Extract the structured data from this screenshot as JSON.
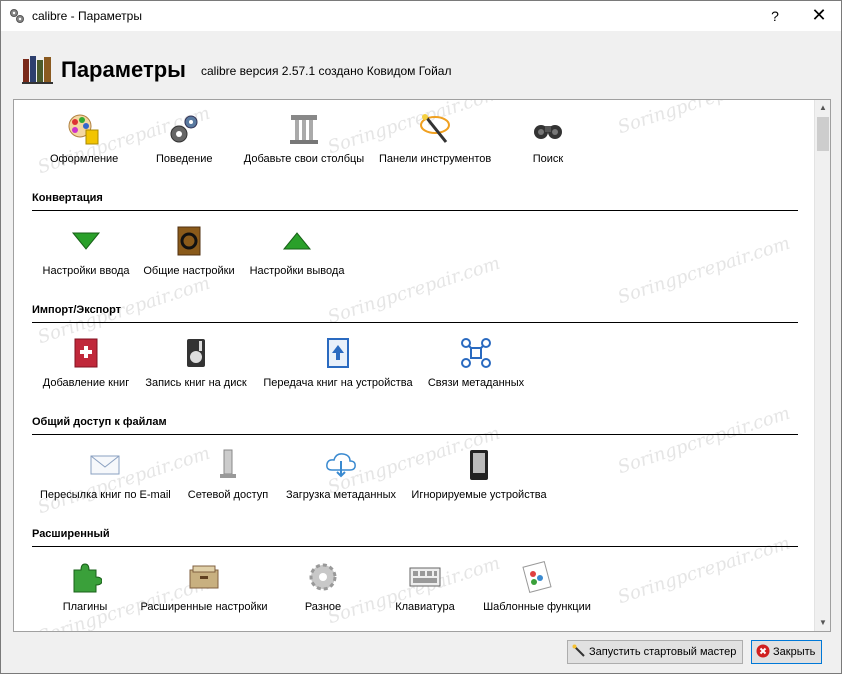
{
  "window": {
    "title": "calibre - Параметры",
    "help_label": "?",
    "close_label": "✕"
  },
  "header": {
    "title": "Параметры",
    "subtitle": "calibre версия 2.57.1 создано Ковидом Гойал"
  },
  "watermark": "Soringpcrepair.com",
  "top_items": [
    {
      "label": "Оформление",
      "icon": "appearance-icon"
    },
    {
      "label": "Поведение",
      "icon": "gears-icon"
    },
    {
      "label": "Добавьте свои столбцы",
      "icon": "column-icon"
    },
    {
      "label": "Панели инструментов",
      "icon": "wand-icon"
    },
    {
      "label": "Поиск",
      "icon": "binoculars-icon"
    }
  ],
  "sections": [
    {
      "title": "Конвертация",
      "items": [
        {
          "label": "Настройки ввода",
          "icon": "arrow-down-icon"
        },
        {
          "label": "Общие настройки",
          "icon": "book-convert-icon"
        },
        {
          "label": "Настройки вывода",
          "icon": "arrow-up-icon"
        }
      ]
    },
    {
      "title": "Импорт/Экспорт",
      "items": [
        {
          "label": "Добавление книг",
          "icon": "add-book-icon"
        },
        {
          "label": "Запись книг на диск",
          "icon": "save-disk-icon"
        },
        {
          "label": "Передача книг на устройства",
          "icon": "send-device-icon"
        },
        {
          "label": "Связи метаданных",
          "icon": "metadata-links-icon"
        }
      ]
    },
    {
      "title": "Общий доступ к файлам",
      "items": [
        {
          "label": "Пересылка книг по E-mail",
          "icon": "email-icon"
        },
        {
          "label": "Сетевой доступ",
          "icon": "network-server-icon"
        },
        {
          "label": "Загрузка метаданных",
          "icon": "cloud-download-icon"
        },
        {
          "label": "Игнорируемые устройства",
          "icon": "ereader-icon"
        }
      ]
    },
    {
      "title": "Расширенный",
      "items": [
        {
          "label": "Плагины",
          "icon": "plugin-icon"
        },
        {
          "label": "Расширенные настройки",
          "icon": "drawer-icon"
        },
        {
          "label": "Разное",
          "icon": "misc-gear-icon"
        },
        {
          "label": "Клавиатура",
          "icon": "keyboard-icon"
        },
        {
          "label": "Шаблонные функции",
          "icon": "template-functions-icon"
        }
      ]
    }
  ],
  "footer": {
    "wizard_label": "Запустить стартовый мастер",
    "close_label": "Закрыть"
  }
}
